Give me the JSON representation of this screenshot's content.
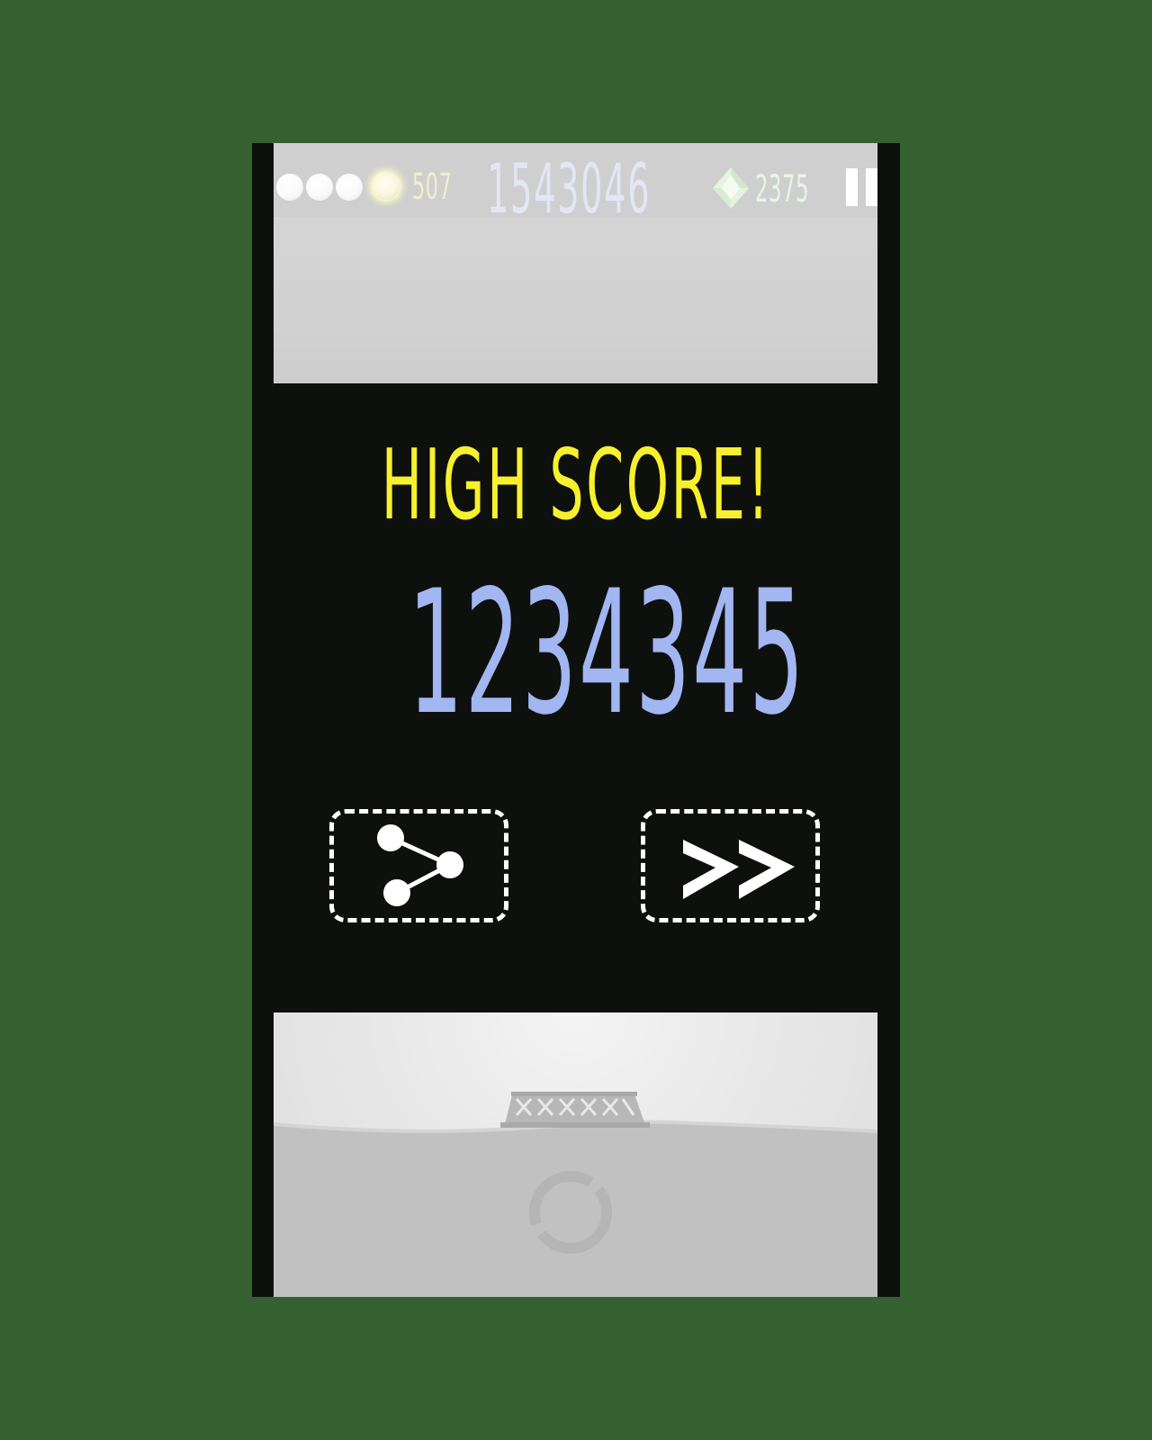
{
  "hud": {
    "lives_total": 4,
    "coin_count": "507",
    "score": "1543046",
    "gem_count": "2375",
    "pause_icon": "pause-icon"
  },
  "overlay": {
    "headline": "HIGH SCORE!",
    "score": "1234345",
    "share_icon": "share-icon",
    "next_icon": "fast-forward-icon"
  },
  "colors": {
    "background": "#356131",
    "headline": "#f7f12d",
    "score": "#a2b6f2",
    "hud_score": "#e3e6f4",
    "coin_text": "#efefcf",
    "gem_text": "#e9f5e3"
  }
}
